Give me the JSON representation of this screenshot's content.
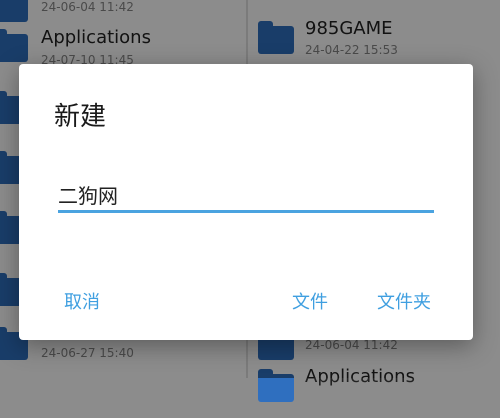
{
  "background": {
    "left_items": [
      {
        "name": "",
        "date": "24-06-04 11:42"
      },
      {
        "name": "Applications",
        "date": "24-07-10 11:45"
      },
      {
        "name": "",
        "date": ""
      },
      {
        "name": "",
        "date": ""
      },
      {
        "name": "",
        "date": ""
      },
      {
        "name": "",
        "date": ""
      },
      {
        "name": "",
        "date": "24-06-27 15:40"
      }
    ],
    "right_items": [
      {
        "name": "985GAME",
        "date": "24-04-22 15:53"
      },
      {
        "name": "",
        "date": "24-06-04 11:42"
      },
      {
        "name": "Applications",
        "date": ""
      }
    ]
  },
  "dialog": {
    "title": "新建",
    "input_value": "二狗网",
    "cancel_label": "取消",
    "file_label": "文件",
    "folder_label": "文件夹"
  },
  "colors": {
    "accent": "#3f9fe0",
    "folder": "#2f6fbf"
  }
}
